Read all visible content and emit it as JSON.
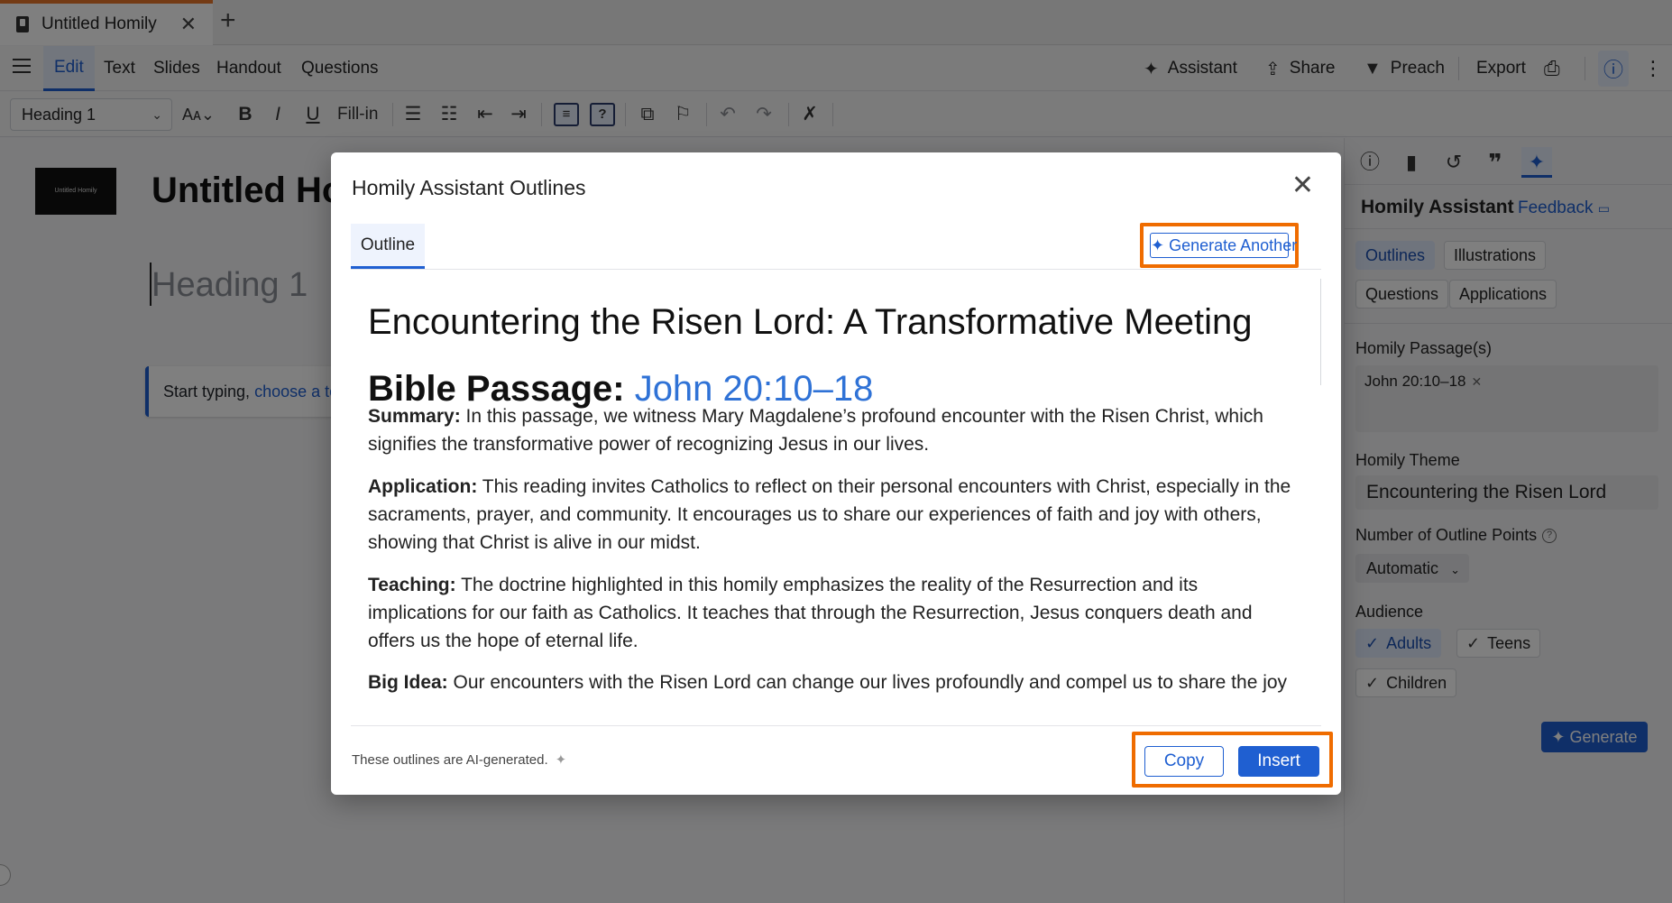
{
  "browser": {
    "tab_title": "Untitled Homily",
    "tab_close": "✕",
    "new_tab": "+"
  },
  "menu": {
    "items": [
      "Edit",
      "Text",
      "Slides",
      "Handout",
      "Questions"
    ],
    "active": "Edit",
    "actions": {
      "assistant": "Assistant",
      "share": "Share",
      "preach": "Preach",
      "export": "Export"
    }
  },
  "toolbar": {
    "style_select": "Heading 1",
    "fill_in": "Fill-in"
  },
  "editor": {
    "thumbnail_text": "Untitled Homily",
    "doc_title": "Untitled Homily",
    "heading_placeholder": "Heading 1",
    "hint_prefix": "Start typing, ",
    "hint_link": "choose a template"
  },
  "sidebar": {
    "title": "Homily Assistant",
    "feedback": "Feedback",
    "categories": [
      "Outlines",
      "Illustrations",
      "Questions",
      "Applications"
    ],
    "selected_category": "Outlines",
    "passage_label": "Homily Passage(s)",
    "passage_value": "John 20:10–18",
    "theme_label": "Homily Theme",
    "theme_value": "Encountering the Risen Lord",
    "points_label": "Number of Outline Points",
    "points_value": "Automatic",
    "audience_label": "Audience",
    "audience": [
      {
        "label": "Adults",
        "selected": true
      },
      {
        "label": "Teens",
        "selected": false
      },
      {
        "label": "Children",
        "selected": false
      }
    ],
    "generate_label": "Generate"
  },
  "modal": {
    "title": "Homily Assistant Outlines",
    "close": "✕",
    "tab": "Outline",
    "generate_another": "Generate Another",
    "outline_title": "Encountering the Risen Lord: A Transformative Meeting",
    "passage_prefix": "Bible Passage: ",
    "passage_ref": "John 20:10–18",
    "sections": [
      {
        "label": "Summary:",
        "text": " In this passage, we witness Mary Magdalene’s profound encounter with the Risen Christ, which signifies the transformative power of recognizing Jesus in our lives."
      },
      {
        "label": "Application:",
        "text": " This reading invites Catholics to reflect on their personal encounters with Christ, especially in the sacraments, prayer, and community. It encourages us to share our experiences of faith and joy with others, showing that Christ is alive in our midst."
      },
      {
        "label": "Teaching:",
        "text": " The doctrine highlighted in this homily emphasizes the reality of the Resurrection and its implications for our faith as Catholics. It teaches that through the Resurrection, Jesus conquers death and offers us the hope of eternal life."
      },
      {
        "label": "Big Idea:",
        "text": " Our encounters with the Risen Lord can change our lives profoundly and compel us to share the joy"
      }
    ],
    "ai_note": "These outlines are AI-generated.",
    "copy_label": "Copy",
    "insert_label": "Insert"
  },
  "colors": {
    "accent": "#1f5fd1",
    "highlight": "#ef6c00",
    "tab_indicator": "#e8762b"
  }
}
